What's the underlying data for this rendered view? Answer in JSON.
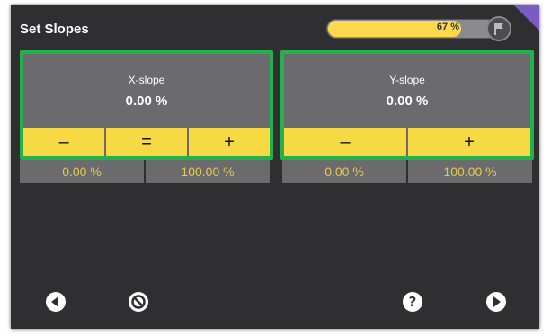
{
  "header": {
    "title": "Set Slopes",
    "progress_text": "67 %",
    "progress_fraction": 0.67
  },
  "panels": [
    {
      "label": "X-slope",
      "value": "0.00 %",
      "buttons": [
        "–",
        "=",
        "+"
      ],
      "limits": [
        "0.00 %",
        "100.00 %"
      ]
    },
    {
      "label": "Y-slope",
      "value": "0.00 %",
      "buttons": [
        "–",
        "+"
      ],
      "limits": [
        "0.00 %",
        "100.00 %"
      ]
    }
  ],
  "footer": {
    "icons": [
      "back-icon",
      "cancel-icon",
      "help-icon",
      "next-icon"
    ]
  },
  "colors": {
    "background": "#2f2f31",
    "panel": "#6b6b6e",
    "selection_border": "#23b14d",
    "button_yellow": "#f6d943",
    "limit_text": "#e7c94a",
    "progress_fill": "#ffd84d",
    "corner_accent": "#7b5cc4"
  }
}
